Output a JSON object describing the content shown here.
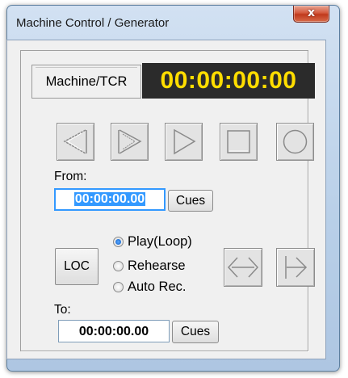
{
  "window": {
    "title": "Machine Control / Generator",
    "close_glyph": "x"
  },
  "display": {
    "label": "Machine/TCR",
    "timecode": "00:00:00:00",
    "timecode_color": "#ffdd00"
  },
  "transport": [
    {
      "name": "rewind-icon"
    },
    {
      "name": "fast-forward-icon"
    },
    {
      "name": "play-icon"
    },
    {
      "name": "stop-icon"
    },
    {
      "name": "record-icon"
    }
  ],
  "from": {
    "label": "From:",
    "value": "00:00:00.00",
    "cues_label": "Cues"
  },
  "loc_label": "LOC",
  "mode": {
    "options": [
      "Play(Loop)",
      "Rehearse",
      "Auto Rec."
    ],
    "selected": "Play(Loop)"
  },
  "aux_icons": [
    "loop-range-icon",
    "go-to-end-icon"
  ],
  "to": {
    "label": "To:",
    "value": "00:00:00.00",
    "cues_label": "Cues"
  }
}
